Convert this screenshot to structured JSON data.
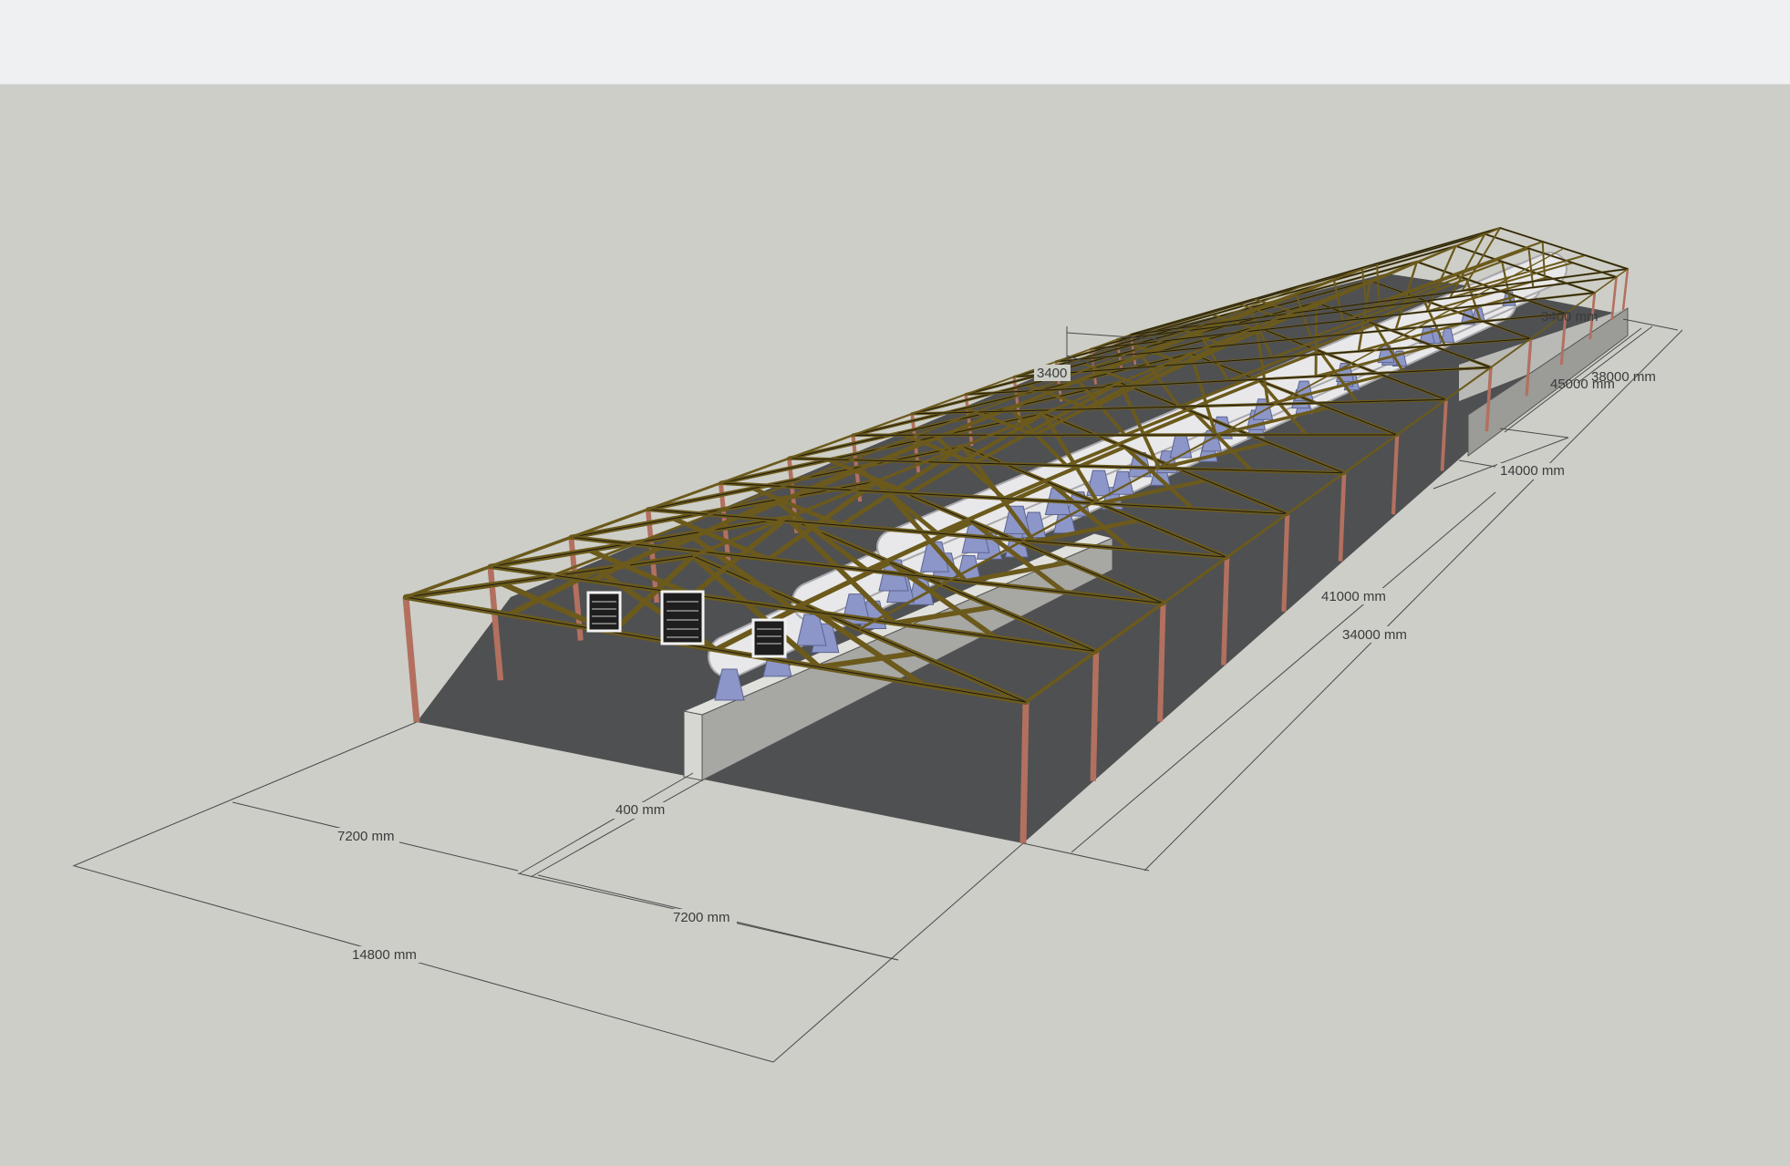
{
  "dimensions": {
    "d1": "7200 mm",
    "d2": "14800 mm",
    "d3": "400 mm",
    "d4": "7200 mm",
    "d5": "41000 mm",
    "d6": "34000 mm",
    "d7": "14000 mm",
    "d8": "45000 mm",
    "d9": "38000 mm",
    "d10": "3400",
    "d11": "3400 mm"
  },
  "colors": {
    "viewport_bg": "#cdcec8",
    "floor": "#4f5052",
    "truss": "#6b5a1c",
    "column": "#b3705f",
    "wall": "#c9c9c5",
    "duct": "#e8e8ea",
    "diffuser": "#8c96c8"
  },
  "model": {
    "bay_count": 14,
    "fan_count": 3
  }
}
